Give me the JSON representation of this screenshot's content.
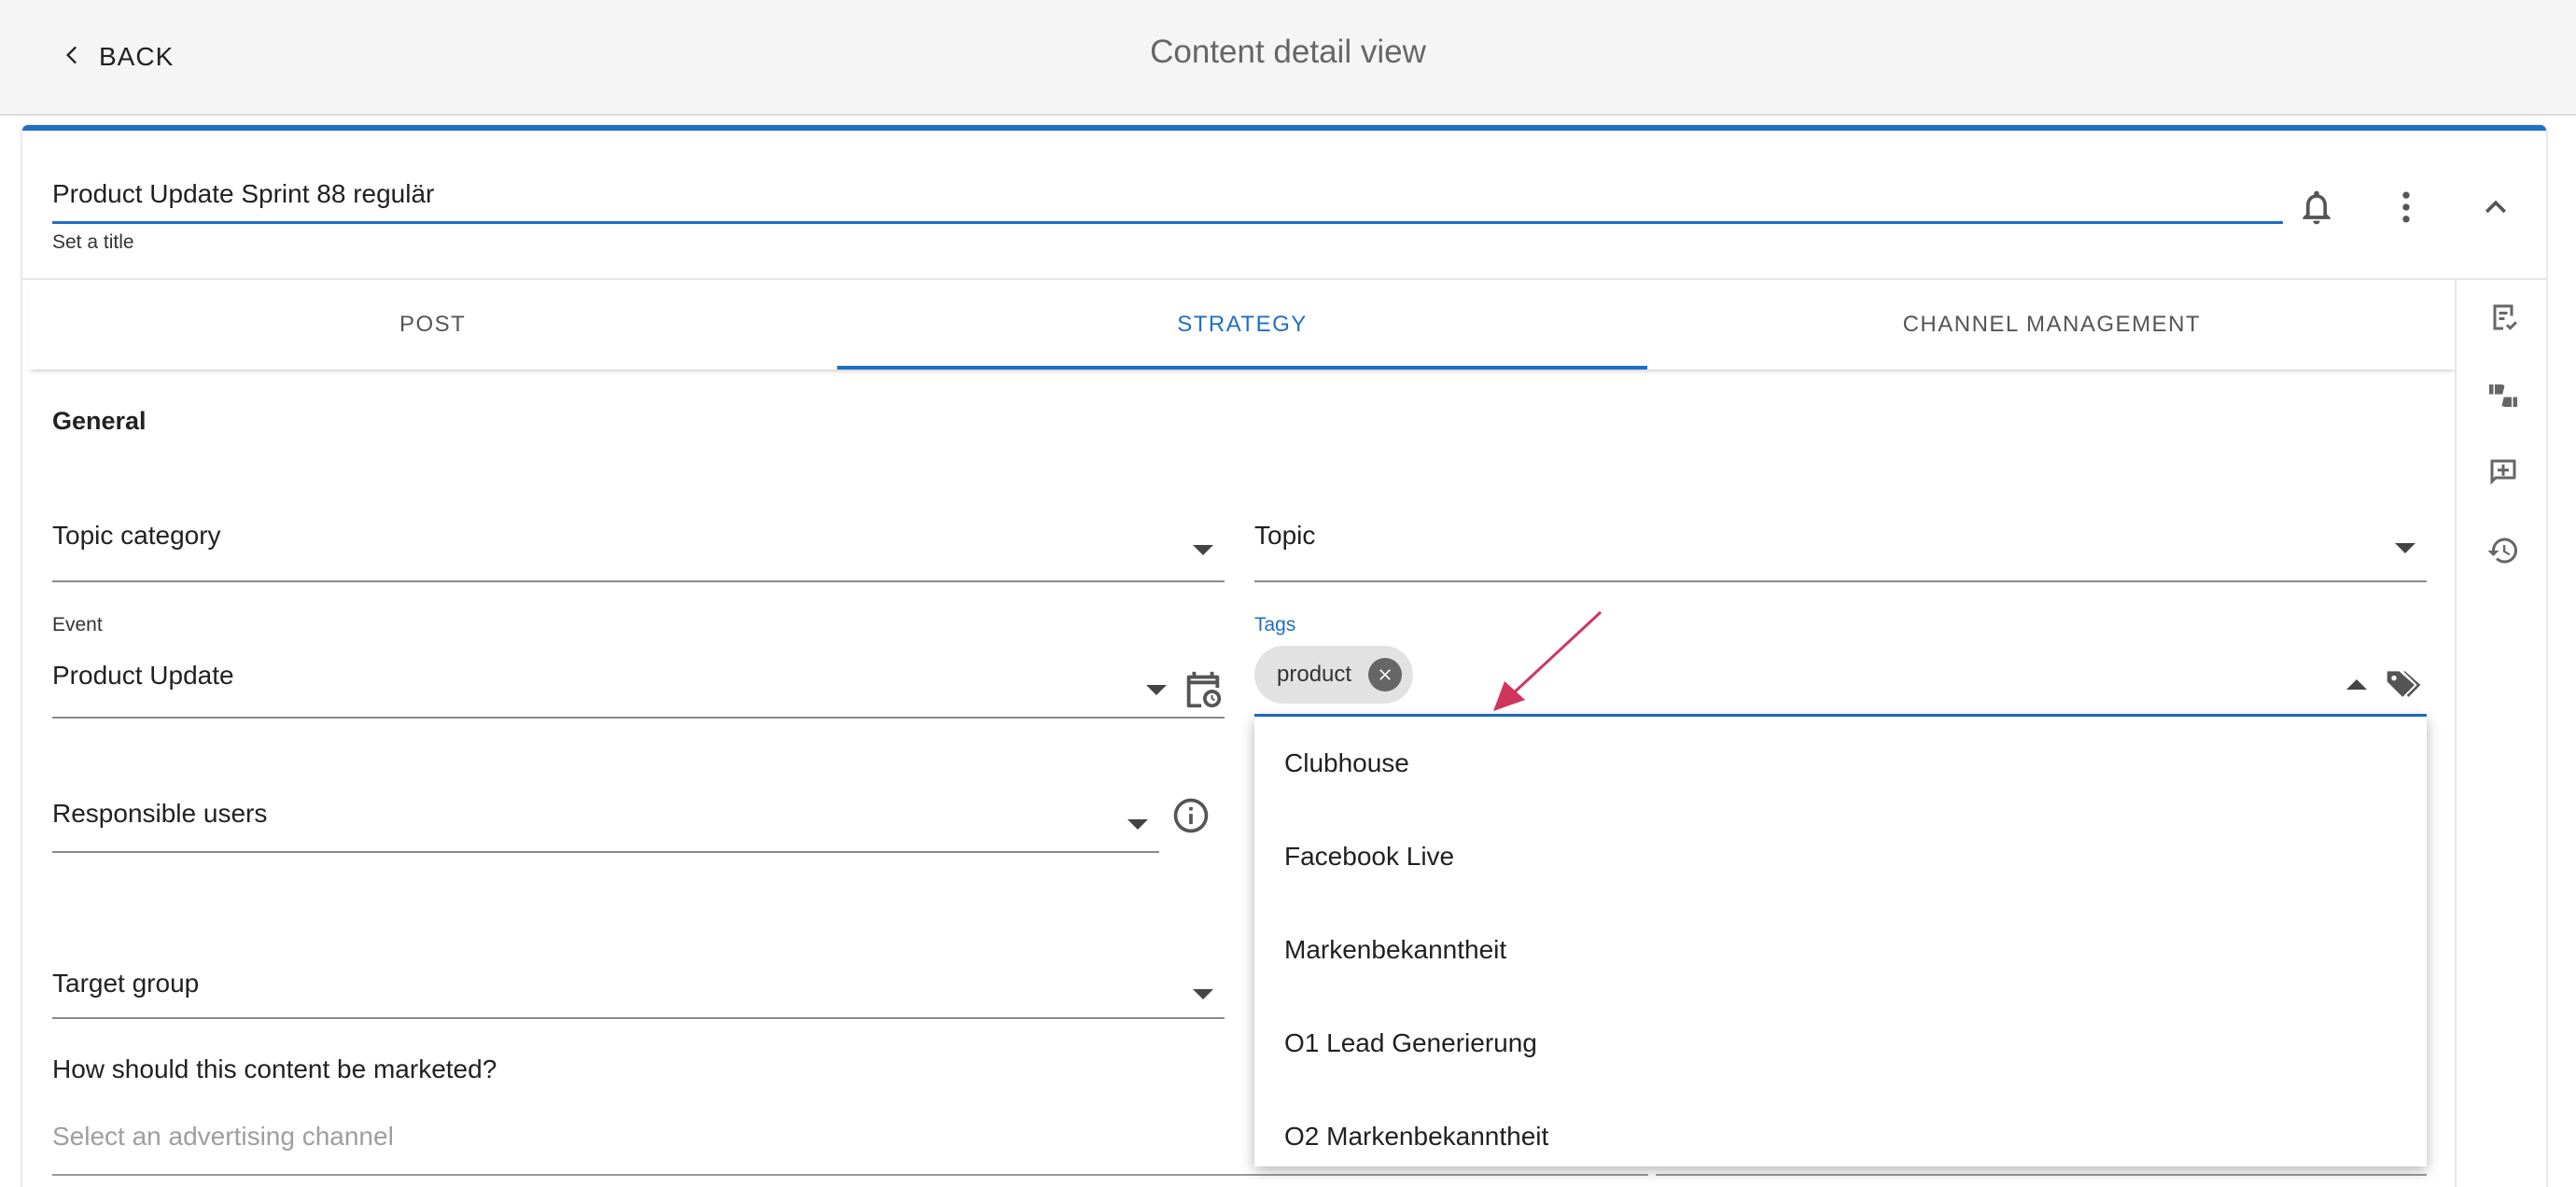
{
  "topbar": {
    "back_label": "BACK",
    "page_title": "Content detail view"
  },
  "header": {
    "title_value": "Product Update Sprint 88 regulär",
    "title_helper": "Set a title"
  },
  "tabs": [
    {
      "label": "POST",
      "active": false
    },
    {
      "label": "STRATEGY",
      "active": true
    },
    {
      "label": "CHANNEL MANAGEMENT",
      "active": false
    }
  ],
  "general": {
    "section_title": "General",
    "topic_category_label": "Topic category",
    "topic_label": "Topic",
    "event_label": "Event",
    "event_value": "Product Update",
    "tags_label": "Tags",
    "tag_chip": "product",
    "responsible_users_label": "Responsible users",
    "target_group_label": "Target group",
    "marketing_question": "How should this content be marketed?",
    "advertising_placeholder": "Select an advertising channel"
  },
  "tags_dropdown": {
    "options": [
      "Clubhouse",
      "Facebook Live",
      "Markenbekanntheit",
      "O1 Lead Generierung",
      "O2 Markenbekanntheit"
    ]
  },
  "colors": {
    "accent": "#1e6fc8",
    "arrow_annotation": "#d0355e"
  },
  "icons": {
    "back": "chevron-left-icon",
    "bell": "bell-icon",
    "more": "more-vert-icon",
    "collapse": "chevron-up-icon",
    "rail": [
      "checklist-icon",
      "thumbs-up-down-icon",
      "add-comment-icon",
      "history-icon"
    ],
    "event_calendar": "calendar-clock-icon",
    "info": "info-icon",
    "tags": "tags-icon"
  }
}
